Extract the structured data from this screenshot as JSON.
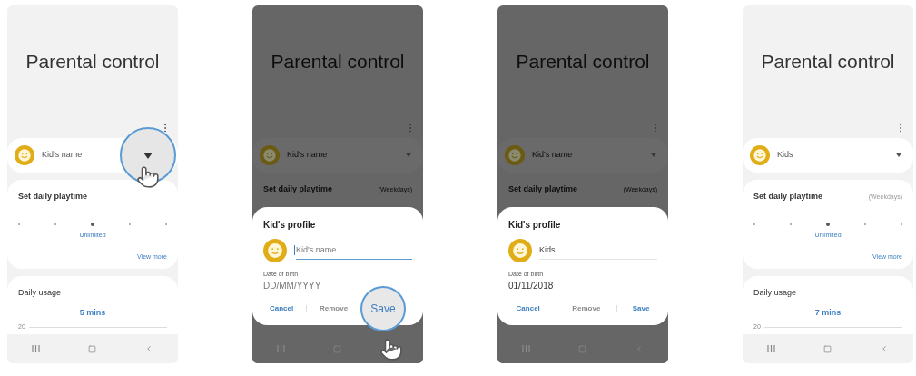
{
  "phones": [
    {
      "dimmed": false,
      "title": "Parental control",
      "profile": {
        "name": "Kid's name",
        "dropdown_tapped": true
      },
      "playtime": {
        "title": "Set daily playtime",
        "level": 0.5,
        "selected_label": "Unlimited",
        "link": "View more"
      },
      "usage": {
        "title": "Daily usage",
        "value": "5 mins",
        "axis_label": "20"
      }
    },
    {
      "dimmed": true,
      "title": "Parental control",
      "profile": {
        "name": "Kid's name",
        "dropdown_tapped": false
      },
      "playtime": {
        "title": "Set daily playtime",
        "period": "(Weekdays)"
      },
      "dialog": {
        "title": "Kid's profile",
        "name_field": {
          "placeholder": "Kid's name",
          "focused": true
        },
        "date_label": "Date of birth",
        "date_field": {
          "placeholder": "DD/MM/YYYY"
        },
        "buttons": [
          {
            "label": "Cancel",
            "disabled": false,
            "tapped": false
          },
          {
            "label": "Remove",
            "disabled": true,
            "tapped": false
          },
          {
            "label": "Save",
            "disabled": false,
            "tapped": true
          }
        ]
      }
    },
    {
      "dimmed": true,
      "title": "Parental control",
      "profile": {
        "name": "Kid's name",
        "dropdown_tapped": false
      },
      "playtime": {
        "title": "Set daily playtime",
        "period": "(Weekdays)"
      },
      "dialog": {
        "title": "Kid's profile",
        "name_field": {
          "value": "Kids",
          "focused": false
        },
        "date_label": "Date of birth",
        "date_field": {
          "value": "01/11/2018"
        },
        "buttons": [
          {
            "label": "Cancel",
            "disabled": false,
            "tapped": false
          },
          {
            "label": "Remove",
            "disabled": true,
            "tapped": false
          },
          {
            "label": "Save",
            "disabled": false,
            "tapped": false
          }
        ]
      }
    },
    {
      "dimmed": false,
      "title": "Parental control",
      "profile": {
        "name": "Kids",
        "dropdown_tapped": false
      },
      "playtime": {
        "title": "Set daily playtime",
        "period": "(Weekdays)",
        "level": 0.5,
        "selected_label": "Unlimited",
        "link": "View more"
      },
      "usage": {
        "title": "Daily usage",
        "value": "7 mins",
        "axis_label": "20"
      }
    }
  ]
}
